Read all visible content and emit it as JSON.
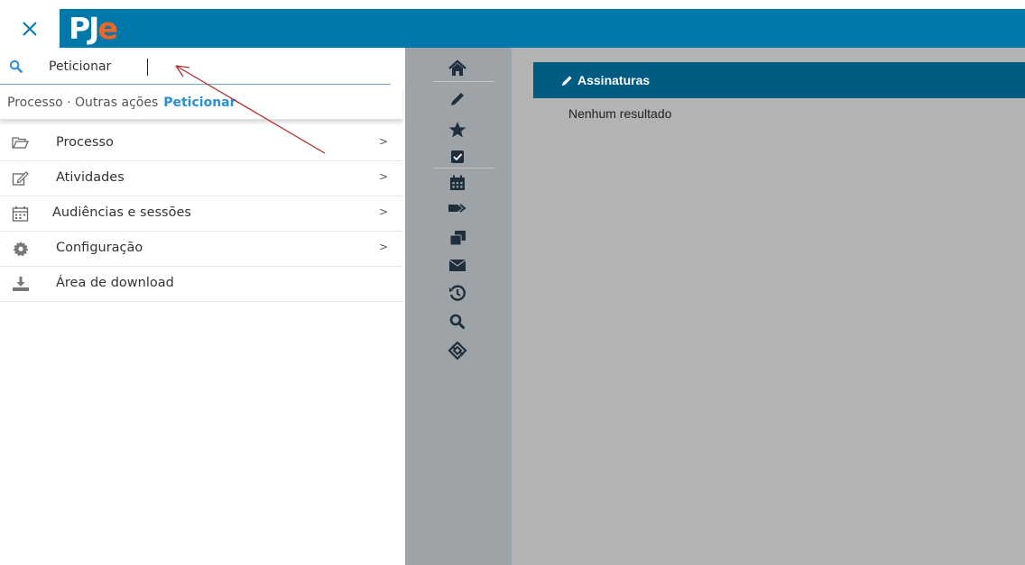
{
  "header": {
    "logo": {
      "pj": "PJ",
      "e": "e"
    },
    "brand_color": "#0078aa",
    "logo_accent_color": "#f26522",
    "close_icon": "close-icon"
  },
  "search": {
    "icon": "search-icon",
    "value": "Peticionar"
  },
  "suggestion": {
    "path": "Processo · Outras ações",
    "target": "Peticionar"
  },
  "menu": {
    "items": [
      {
        "label": "Processo",
        "icon": "folder-open-icon",
        "has_submenu": true,
        "chevron": ">"
      },
      {
        "label": "Atividades",
        "icon": "edit-icon",
        "has_submenu": true,
        "chevron": ">"
      },
      {
        "label": "Audiências e sessões",
        "icon": "calendar-icon",
        "has_submenu": true,
        "chevron": ">"
      },
      {
        "label": "Configuração",
        "icon": "gear-icon",
        "has_submenu": true,
        "chevron": ">"
      },
      {
        "label": "Área de download",
        "icon": "download-icon",
        "has_submenu": false
      }
    ]
  },
  "sidebar_icons": [
    "home-icon",
    "pencil-icon",
    "star-icon",
    "checkbox-icon",
    "calendar-icon",
    "tags-icon",
    "clone-icon",
    "envelope-icon",
    "history-icon",
    "search-icon",
    "cube-icon"
  ],
  "main": {
    "panel_title": "Assinaturas",
    "panel_icon": "pencil-icon",
    "empty_text": "Nenhum resultado",
    "panel_header_color": "#005b82"
  }
}
